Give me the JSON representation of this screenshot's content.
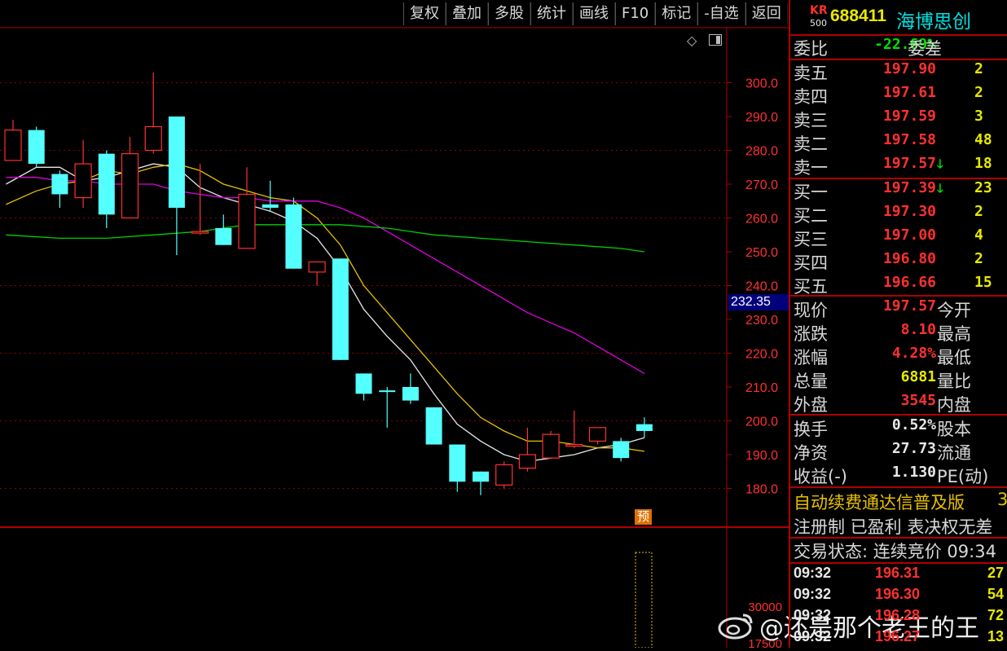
{
  "toolbar": [
    "复权",
    "叠加",
    "多股",
    "统计",
    "画线",
    "F10",
    "标记",
    "-自选",
    "返回"
  ],
  "stock": {
    "badge_top": "KR",
    "badge_bottom": "500",
    "code": "688411",
    "name": "海博思创"
  },
  "weibi": {
    "label": "委比",
    "value": "-22.69%",
    "label2": "委差"
  },
  "asks": [
    {
      "label": "卖五",
      "price": "197.90",
      "vol": "2"
    },
    {
      "label": "卖四",
      "price": "197.61",
      "vol": "2"
    },
    {
      "label": "卖三",
      "price": "197.59",
      "vol": "3"
    },
    {
      "label": "卖二",
      "price": "197.58",
      "vol": "48"
    },
    {
      "label": "卖一",
      "price": "197.57",
      "vol": "18",
      "arrow": "down-arrow"
    }
  ],
  "bids": [
    {
      "label": "买一",
      "price": "197.39",
      "vol": "23",
      "arrow": "down-arrow"
    },
    {
      "label": "买二",
      "price": "197.30",
      "vol": "2"
    },
    {
      "label": "买三",
      "price": "197.00",
      "vol": "4"
    },
    {
      "label": "买四",
      "price": "196.80",
      "vol": "2"
    },
    {
      "label": "买五",
      "price": "196.66",
      "vol": "15"
    }
  ],
  "stats": [
    {
      "label": "现价",
      "value": "197.57",
      "color": "#ff3030",
      "label2": "今开"
    },
    {
      "label": "涨跌",
      "value": "8.10",
      "color": "#ff3030",
      "label2": "最高"
    },
    {
      "label": "涨幅",
      "value": "4.28%",
      "color": "#ff3030",
      "label2": "最低"
    },
    {
      "label": "总量",
      "value": "6881",
      "color": "#e8e800",
      "label2": "量比"
    },
    {
      "label": "外盘",
      "value": "3545",
      "color": "#ff3030",
      "label2": "内盘"
    }
  ],
  "stats2": [
    {
      "label": "换手",
      "value": "0.52%",
      "label2": "股本"
    },
    {
      "label": "净资",
      "value": "27.73",
      "label2": "流通"
    },
    {
      "label": "收益(-)",
      "value": "1.130",
      "label2": "PE(动)"
    }
  ],
  "notice": {
    "text": "自动续费通达信普及版",
    "num": "3"
  },
  "tags": "注册制 已盈利 表决权无差",
  "trade_status": "交易状态: 连续竞价 09:34",
  "ticks": [
    {
      "time": "09:32",
      "price": "196.31",
      "vol": "27"
    },
    {
      "time": "09:32",
      "price": "196.30",
      "vol": "54"
    },
    {
      "time": "09:32",
      "price": "196.28",
      "vol": "72"
    },
    {
      "time": "09:32",
      "price": "196.27",
      "vol": "13"
    }
  ],
  "watermark": "@还是那个老王的王",
  "current_price_label": "232.35",
  "pre_marker": "预",
  "volume_axis": [
    "30000",
    "17500"
  ],
  "chart_data": {
    "type": "candlestick",
    "y_ticks": [
      300,
      290,
      280,
      270,
      260,
      250,
      240,
      230,
      220,
      210,
      200,
      190,
      180
    ],
    "ylim": [
      175.5,
      305.2
    ],
    "candles": [
      {
        "o": 277,
        "c": 286,
        "h": 289,
        "l": 277,
        "up": true
      },
      {
        "o": 286,
        "c": 276,
        "h": 287,
        "l": 275,
        "up": false
      },
      {
        "o": 273,
        "c": 267,
        "h": 274,
        "l": 263,
        "up": false
      },
      {
        "o": 266,
        "c": 276,
        "h": 283,
        "l": 263,
        "up": true
      },
      {
        "o": 279,
        "c": 261,
        "h": 280,
        "l": 257,
        "up": false
      },
      {
        "o": 260,
        "c": 279,
        "h": 284,
        "l": 260,
        "up": true
      },
      {
        "o": 280,
        "c": 287,
        "h": 303,
        "l": 279,
        "up": true
      },
      {
        "o": 290,
        "c": 263,
        "h": 290,
        "l": 249,
        "up": false
      },
      {
        "o": 256,
        "c": 256,
        "h": 276,
        "l": 255,
        "up": true
      },
      {
        "o": 257,
        "c": 252,
        "h": 261,
        "l": 252,
        "up": false
      },
      {
        "o": 251,
        "c": 267,
        "h": 275,
        "l": 251,
        "up": true
      },
      {
        "o": 264,
        "c": 263,
        "h": 271,
        "l": 262,
        "up": false
      },
      {
        "o": 264,
        "c": 245,
        "h": 266,
        "l": 245,
        "up": false
      },
      {
        "o": 247,
        "c": 244,
        "h": 247,
        "l": 240,
        "up": true
      },
      {
        "o": 248,
        "c": 218,
        "h": 248,
        "l": 218,
        "up": false
      },
      {
        "o": 214,
        "c": 208,
        "h": 214,
        "l": 206,
        "up": false
      },
      {
        "o": 209,
        "c": 209,
        "h": 210,
        "l": 198,
        "up": false
      },
      {
        "o": 210,
        "c": 206,
        "h": 214,
        "l": 205,
        "up": false
      },
      {
        "o": 204,
        "c": 193,
        "h": 204,
        "l": 193,
        "up": false
      },
      {
        "o": 193,
        "c": 182,
        "h": 193,
        "l": 179,
        "up": false
      },
      {
        "o": 185,
        "c": 182,
        "h": 185,
        "l": 178,
        "up": false
      },
      {
        "o": 181,
        "c": 187,
        "h": 188,
        "l": 180,
        "up": true
      },
      {
        "o": 186,
        "c": 190,
        "h": 198,
        "l": 185,
        "up": true
      },
      {
        "o": 189,
        "c": 196,
        "h": 197,
        "l": 189,
        "up": true
      },
      {
        "o": 193,
        "c": 193,
        "h": 203,
        "l": 192,
        "up": true
      },
      {
        "o": 194,
        "c": 198,
        "h": 198,
        "l": 193,
        "up": true
      },
      {
        "o": 194,
        "c": 189,
        "h": 195,
        "l": 188,
        "up": false
      },
      {
        "o": 199,
        "c": 197,
        "h": 201,
        "l": 195,
        "up": false
      }
    ],
    "ma": [
      {
        "name": "white",
        "color": "#e8e8e8",
        "points": [
          [
            -0.3,
            270
          ],
          [
            1,
            275
          ],
          [
            2,
            275
          ],
          [
            3,
            271
          ],
          [
            4,
            272
          ],
          [
            5,
            274
          ],
          [
            6,
            276
          ],
          [
            7,
            275
          ],
          [
            8,
            269
          ],
          [
            9,
            266
          ],
          [
            10,
            264
          ],
          [
            11,
            262
          ],
          [
            12,
            259
          ],
          [
            13,
            254
          ],
          [
            14,
            245
          ],
          [
            15,
            233
          ],
          [
            16,
            225
          ],
          [
            17,
            218
          ],
          [
            18,
            208
          ],
          [
            19,
            199
          ],
          [
            20,
            194
          ],
          [
            21,
            190
          ],
          [
            22,
            188
          ],
          [
            23,
            189
          ],
          [
            24,
            190
          ],
          [
            25,
            192
          ],
          [
            26,
            193
          ],
          [
            27,
            195
          ]
        ]
      },
      {
        "name": "yellow",
        "color": "#e8c000",
        "points": [
          [
            -0.3,
            264
          ],
          [
            1,
            268
          ],
          [
            2,
            270
          ],
          [
            3,
            271
          ],
          [
            4,
            274
          ],
          [
            5,
            273
          ],
          [
            6,
            275
          ],
          [
            7,
            276
          ],
          [
            8,
            274
          ],
          [
            9,
            270
          ],
          [
            10,
            268
          ],
          [
            11,
            266
          ],
          [
            12,
            265
          ],
          [
            13,
            260
          ],
          [
            14,
            252
          ],
          [
            15,
            240
          ],
          [
            16,
            232
          ],
          [
            17,
            224
          ],
          [
            18,
            216
          ],
          [
            19,
            208
          ],
          [
            20,
            201
          ],
          [
            21,
            197
          ],
          [
            22,
            194
          ],
          [
            23,
            194
          ],
          [
            24,
            193
          ],
          [
            25,
            192
          ],
          [
            26,
            192
          ],
          [
            27,
            191
          ]
        ]
      },
      {
        "name": "magenta",
        "color": "#e000e0",
        "points": [
          [
            -0.3,
            272
          ],
          [
            1,
            272
          ],
          [
            2,
            271
          ],
          [
            3,
            271
          ],
          [
            4,
            270
          ],
          [
            5,
            270
          ],
          [
            6,
            270
          ],
          [
            7,
            268
          ],
          [
            8,
            267
          ],
          [
            9,
            266
          ],
          [
            10,
            266
          ],
          [
            11,
            265
          ],
          [
            12,
            265
          ],
          [
            13,
            265
          ],
          [
            14,
            263
          ],
          [
            15,
            260
          ],
          [
            16,
            256
          ],
          [
            17,
            252
          ],
          [
            18,
            248
          ],
          [
            19,
            244
          ],
          [
            20,
            240
          ],
          [
            21,
            236
          ],
          [
            22,
            232
          ],
          [
            23,
            229
          ],
          [
            24,
            226
          ],
          [
            25,
            222
          ],
          [
            26,
            218
          ],
          [
            27,
            214
          ]
        ]
      },
      {
        "name": "green",
        "color": "#00d000",
        "points": [
          [
            -0.3,
            255
          ],
          [
            2,
            254
          ],
          [
            4,
            254
          ],
          [
            6,
            255
          ],
          [
            8,
            256
          ],
          [
            10,
            258
          ],
          [
            12,
            258
          ],
          [
            14,
            258
          ],
          [
            16,
            257
          ],
          [
            18,
            255
          ],
          [
            20,
            254
          ],
          [
            22,
            253
          ],
          [
            24,
            252
          ],
          [
            26,
            251
          ],
          [
            27,
            250
          ]
        ]
      }
    ]
  }
}
